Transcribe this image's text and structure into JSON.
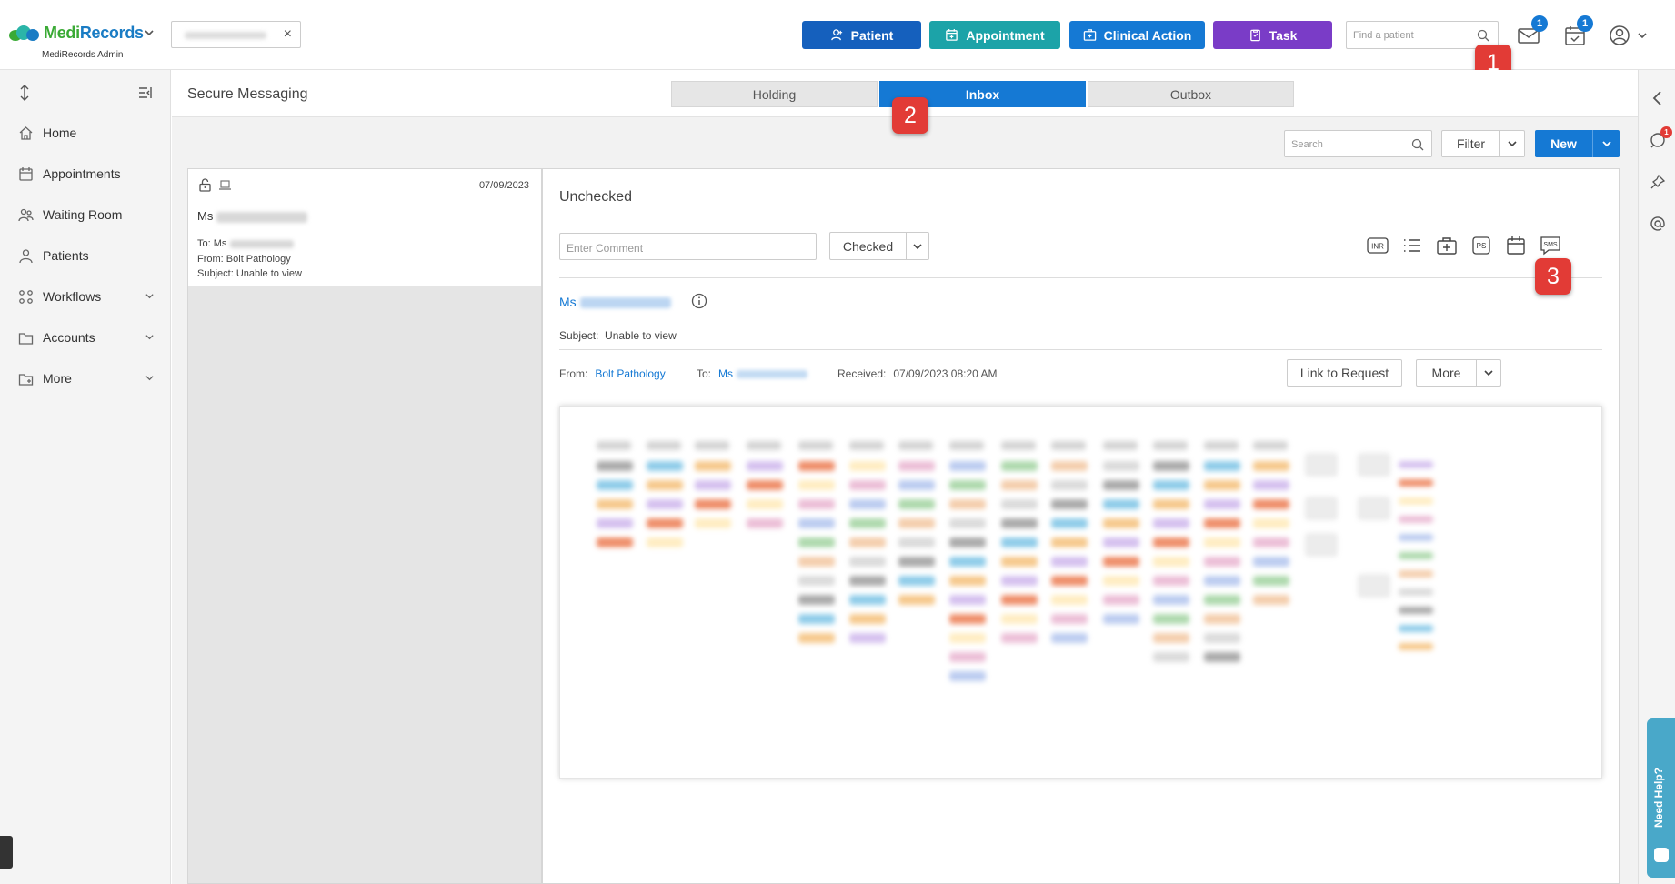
{
  "app": {
    "brand_part1": "Medi",
    "brand_part2": "Records",
    "subtitle": "MediRecords Admin"
  },
  "header": {
    "patient_chip_close": "×",
    "buttons": {
      "patient": "Patient",
      "appointment": "Appointment",
      "clinical_action": "Clinical Action",
      "task": "Task"
    },
    "find_patient_placeholder": "Find a patient",
    "mail_badge": "1",
    "tasks_badge": "1"
  },
  "markers": [
    "1",
    "2",
    "3"
  ],
  "sidebar": {
    "items": [
      {
        "label": "Home",
        "icon": "home-icon"
      },
      {
        "label": "Appointments",
        "icon": "calendar-icon"
      },
      {
        "label": "Waiting Room",
        "icon": "people-icon"
      },
      {
        "label": "Patients",
        "icon": "patients-icon"
      },
      {
        "label": "Workflows",
        "icon": "workflow-icon"
      },
      {
        "label": "Accounts",
        "icon": "folder-icon"
      },
      {
        "label": "More",
        "icon": "more-folder-icon"
      }
    ]
  },
  "main": {
    "title": "Secure Messaging",
    "tabs": [
      {
        "label": "Holding"
      },
      {
        "label": "Inbox"
      },
      {
        "label": "Outbox"
      }
    ],
    "search_placeholder": "Search",
    "filter_label": "Filter",
    "new_label": "New"
  },
  "message_list": {
    "items": [
      {
        "date": "07/09/2023",
        "name_prefix": "Ms",
        "to_label": "To:",
        "to_value": "Ms",
        "from_label": "From:",
        "from_value": "Bolt Pathology",
        "subject_label": "Subject:",
        "subject_value": "Unable to view"
      }
    ]
  },
  "detail": {
    "status": "Unchecked",
    "comment_placeholder": "Enter Comment",
    "checked_label": "Checked",
    "action_icons": [
      "inr-icon",
      "list-icon",
      "medical-kit-icon",
      "ps-icon",
      "calendar-icon",
      "sms-icon"
    ],
    "inr_text": "INR",
    "ps_text": "PS",
    "sms_text": "SMS",
    "patient_prefix": "Ms",
    "subject_label": "Subject:",
    "subject_value": "Unable to view",
    "from_label": "From:",
    "from_value": "Bolt Pathology",
    "to_label": "To:",
    "to_value": "Ms",
    "received_label": "Received:",
    "received_value": "07/09/2023 08:20 AM",
    "link_to_request": "Link to Request",
    "more_label": "More"
  },
  "help": {
    "need_help": "Need Help?",
    "comment_badge": "1"
  },
  "colors": {
    "primary": "#1579d4",
    "patient_btn": "#1560bd",
    "appointment_btn": "#1ca3a8",
    "task_btn": "#7a3cc7",
    "marker": "#e23b36"
  }
}
